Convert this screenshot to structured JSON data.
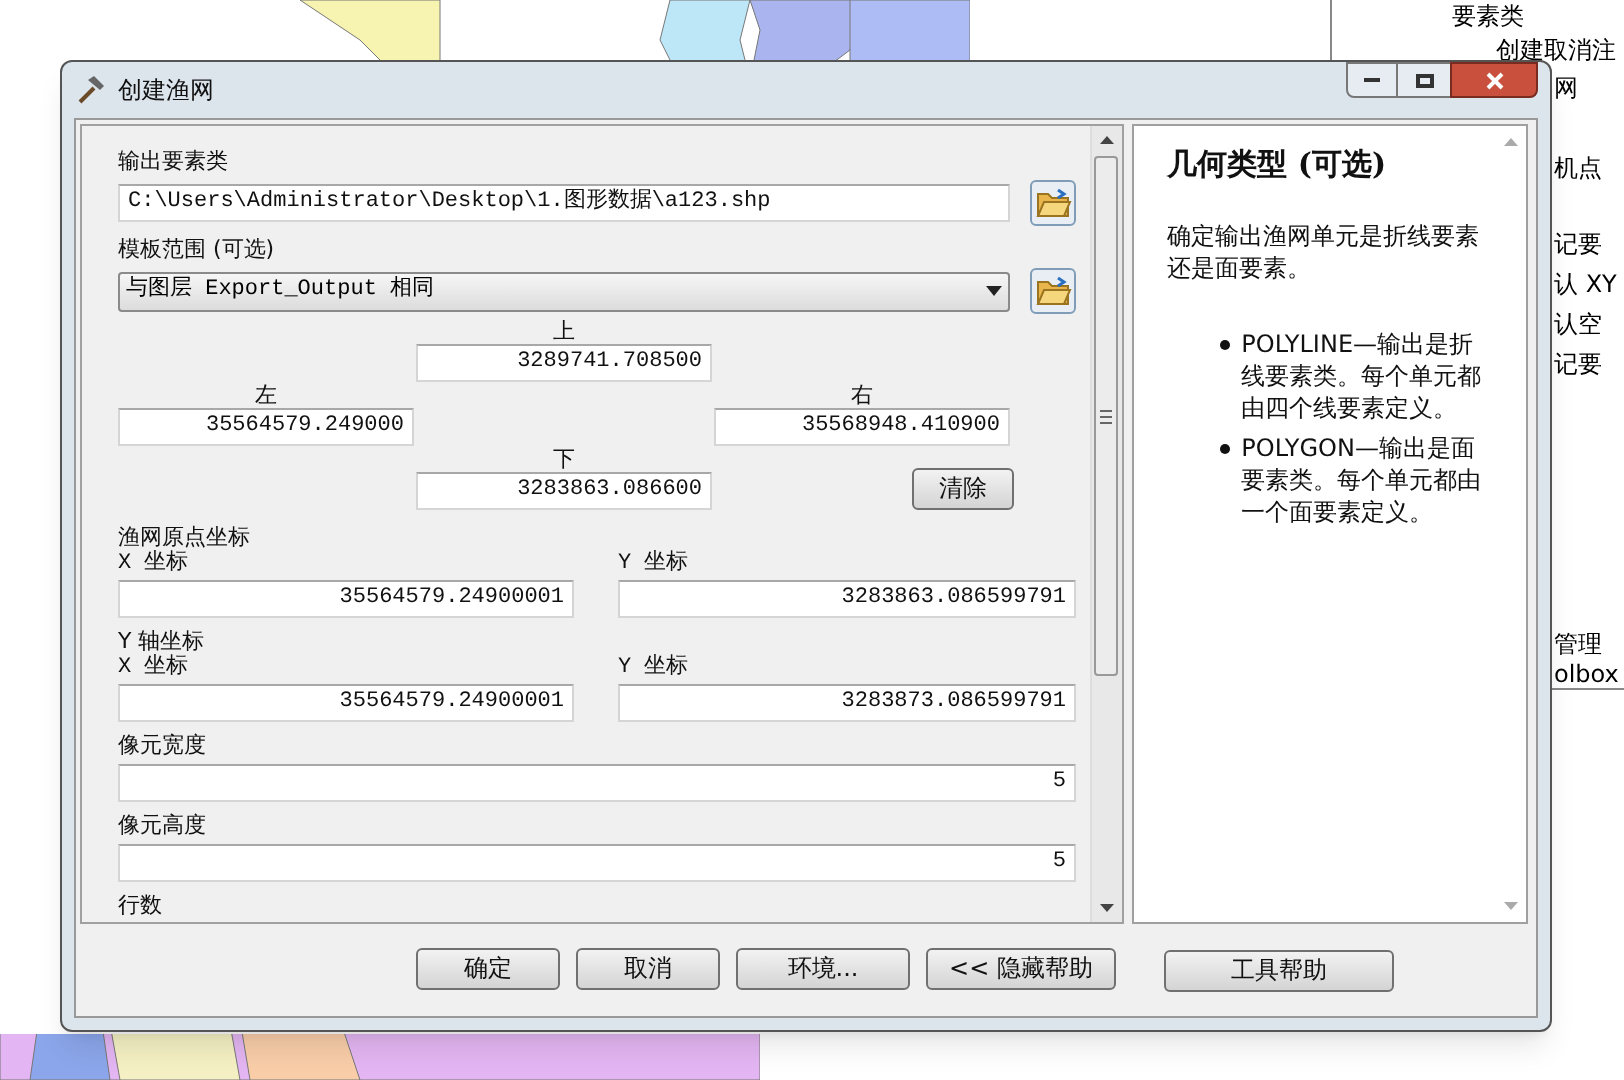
{
  "background_panel": {
    "lines": [
      "要素类",
      "创建取消注",
      "网",
      "机点",
      "记要",
      "认 XY",
      "认空",
      "记要",
      "管理",
      "olbox"
    ]
  },
  "window": {
    "title": "创建渔网"
  },
  "form": {
    "output": {
      "label": "输出要素类",
      "value": "C:\\Users\\Administrator\\Desktop\\1.图形数据\\a123.shp"
    },
    "template": {
      "label": "模板范围 (可选)",
      "value": "与图层 Export_Output 相同",
      "top_label": "上",
      "top_value": "3289741.708500",
      "left_label": "左",
      "left_value": "35564579.249000",
      "right_label": "右",
      "right_value": "35568948.410900",
      "bottom_label": "下",
      "bottom_value": "3283863.086600",
      "clear_button": "清除"
    },
    "origin": {
      "label": "渔网原点坐标",
      "x_label": "X 坐标",
      "x_value": "35564579.24900001",
      "y_label": "Y 坐标",
      "y_value": "3283863.086599791"
    },
    "y_axis": {
      "label": "Y 轴坐标",
      "x_label": "X 坐标",
      "x_value": "35564579.24900001",
      "y_label": "Y 坐标",
      "y_value": "3283873.086599791"
    },
    "cell_width": {
      "label": "像元宽度",
      "value": "5"
    },
    "cell_height": {
      "label": "像元高度",
      "value": "5"
    },
    "rows": {
      "label": "行数"
    }
  },
  "help": {
    "title": "几何类型 (可选)",
    "description": "确定输出渔网单元是折线要素还是面要素。",
    "bullets": [
      "POLYLINE—输出是折线要素类。每个单元都由四个线要素定义。",
      "POLYGON—输出是面要素类。每个单元都由一个面要素定义。"
    ]
  },
  "buttons": [
    "确定",
    "取消",
    "环境...",
    "<< 隐藏帮助"
  ],
  "tool_help_button": "工具帮助"
}
